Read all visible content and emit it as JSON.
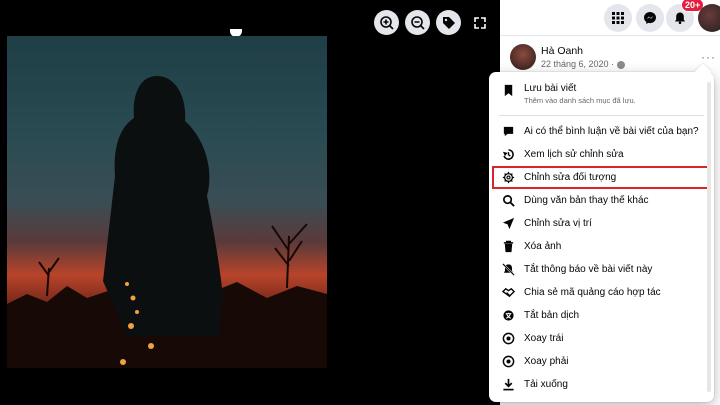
{
  "viewer": {
    "tools": [
      {
        "name": "zoom-in-icon"
      },
      {
        "name": "zoom-out-icon"
      },
      {
        "name": "tag-icon"
      },
      {
        "name": "fullscreen-icon"
      }
    ]
  },
  "topbar": {
    "notification_badge": "20+"
  },
  "post": {
    "author": "Hà Oanh",
    "date": "22 tháng 6, 2020 ·",
    "more": "···"
  },
  "menu": {
    "save_label": "Lưu bài viết",
    "save_sub": "Thêm vào danh sách mục đã lưu.",
    "items": [
      {
        "label": "Ai có thể bình luận về bài viết của bạn?",
        "icon": "comment-icon"
      },
      {
        "label": "Xem lịch sử chỉnh sửa",
        "icon": "history-icon"
      },
      {
        "label": "Chỉnh sửa đối tượng",
        "icon": "gear-icon"
      },
      {
        "label": "Dùng văn bản thay thế khác",
        "icon": "search-icon"
      },
      {
        "label": "Chỉnh sửa vị trí",
        "icon": "location-icon"
      },
      {
        "label": "Xóa ảnh",
        "icon": "trash-icon"
      },
      {
        "label": "Tắt thông báo về bài viết này",
        "icon": "bell-off-icon"
      },
      {
        "label": "Chia sẻ mã quảng cáo hợp tác",
        "icon": "handshake-icon"
      },
      {
        "label": "Tắt bản dịch",
        "icon": "translate-icon"
      },
      {
        "label": "Xoay trái",
        "icon": "rotate-left-icon"
      },
      {
        "label": "Xoay phải",
        "icon": "rotate-right-icon"
      },
      {
        "label": "Tải xuống",
        "icon": "download-icon"
      }
    ],
    "highlight_color": "#d8262f"
  }
}
